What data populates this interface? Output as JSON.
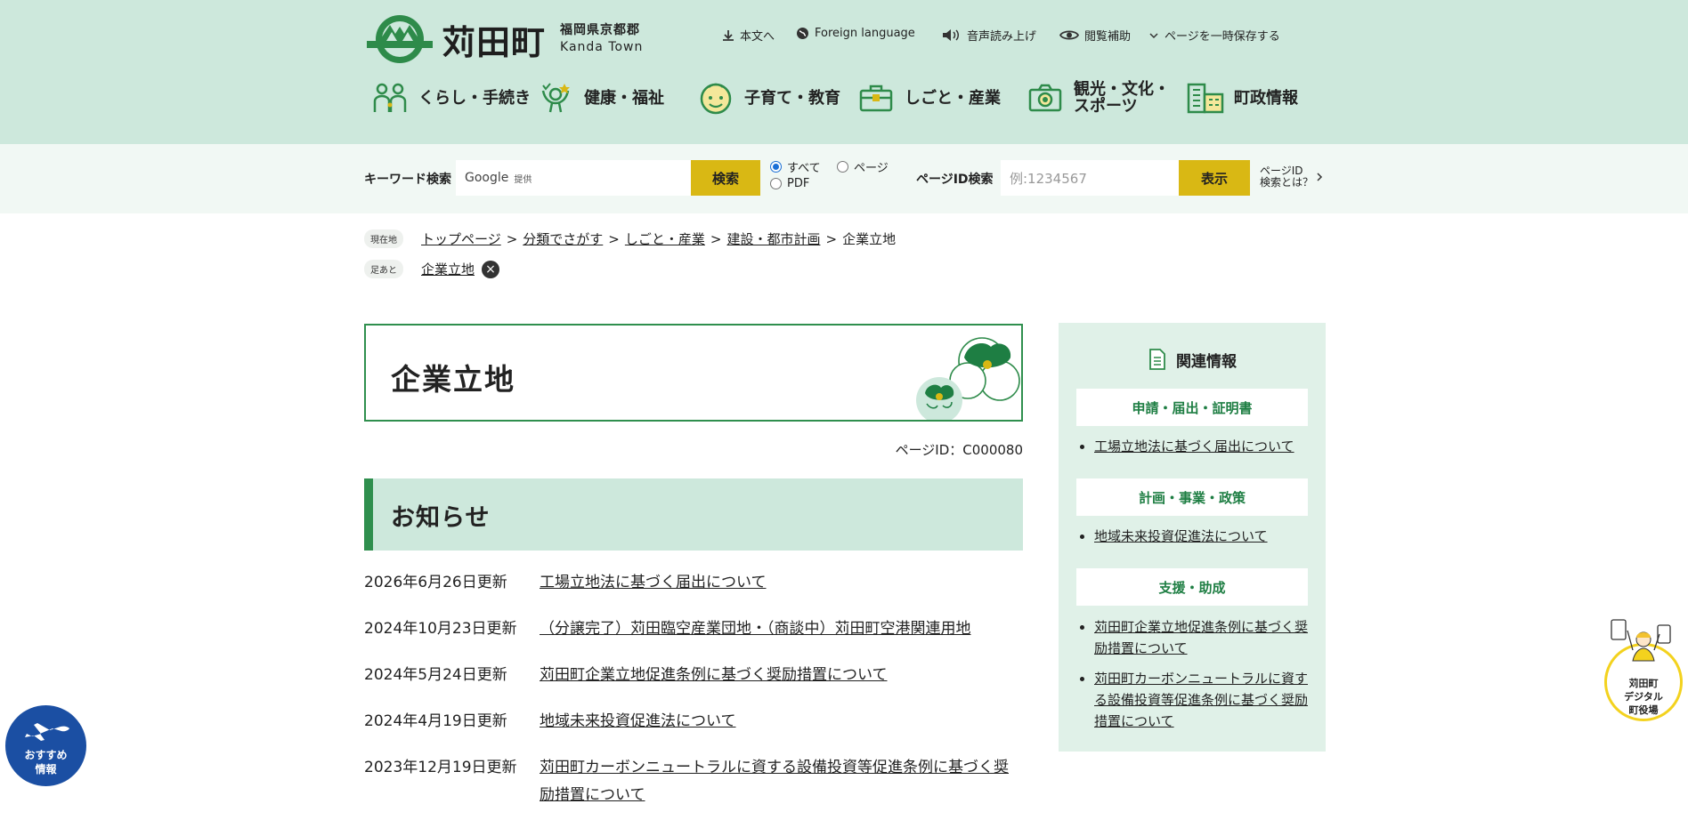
{
  "header": {
    "logo_title": "苅田町",
    "logo_pref": "福岡県京都郡",
    "logo_en": "Kanda Town",
    "utility": {
      "skip": "本文へ",
      "foreign": "Foreign language",
      "speech": "音声読み上げ",
      "assist": "閲覧補助",
      "save": "ページを一時保存する"
    },
    "nav": [
      "くらし・手続き",
      "健康・福祉",
      "子育て・教育",
      "しごと・産業",
      "観光・文化・\nスポーツ",
      "町政情報"
    ]
  },
  "search": {
    "keyword_label": "キーワード検索",
    "google": "Google",
    "google_sub": "提供",
    "button": "検索",
    "radio_all": "すべて",
    "radio_page": "ページ",
    "radio_pdf": "PDF",
    "pageid_label": "ページID検索",
    "pageid_placeholder": "例:1234567",
    "pageid_button": "表示",
    "pageid_help_1": "ページID",
    "pageid_help_2": "検索とは？"
  },
  "breadcrumb": {
    "current_pill": "現在地",
    "items": [
      "トップページ",
      "分類でさがす",
      "しごと・産業",
      "建設・都市計画"
    ],
    "current": "企業立地",
    "history_pill": "足あと",
    "history_item": "企業立地"
  },
  "main": {
    "title": "企業立地",
    "page_id": "ページID：C000080",
    "news_heading": "お知らせ",
    "news": [
      {
        "date": "2026年6月26日更新",
        "title": "工場立地法に基づく届出について"
      },
      {
        "date": "2024年10月23日更新",
        "title": "（分譲完了）苅田臨空産業団地・（商談中）苅田町空港関連用地"
      },
      {
        "date": "2024年5月24日更新",
        "title": "苅田町企業立地促進条例に基づく奨励措置について"
      },
      {
        "date": "2024年4月19日更新",
        "title": "地域未来投資促進法について"
      },
      {
        "date": "2023年12月19日更新",
        "title": "苅田町カーボンニュートラルに資する設備投資等促進条例に基づく奨励措置について"
      }
    ]
  },
  "side": {
    "heading": "関連情報",
    "categories": [
      {
        "name": "申請・届出・証明書",
        "links": [
          "工場立地法に基づく届出について"
        ]
      },
      {
        "name": "計画・事業・政策",
        "links": [
          "地域未来投資促進法について"
        ]
      },
      {
        "name": "支援・助成",
        "links": [
          "苅田町企業立地促進条例に基づく奨励措置について",
          "苅田町カーボンニュートラルに資する設備投資等促進条例に基づく奨励措置について"
        ]
      }
    ]
  },
  "floating": {
    "recommend": "おすすめ\n情報",
    "dx": "苅田町\nデジタル\n町役場"
  },
  "colors": {
    "header_bg": "#cde8dc",
    "accent_green": "#2f8f4e",
    "button_yellow": "#d9b814",
    "side_bg": "#e0f1e8",
    "recommend_blue": "#1b4fa3"
  }
}
